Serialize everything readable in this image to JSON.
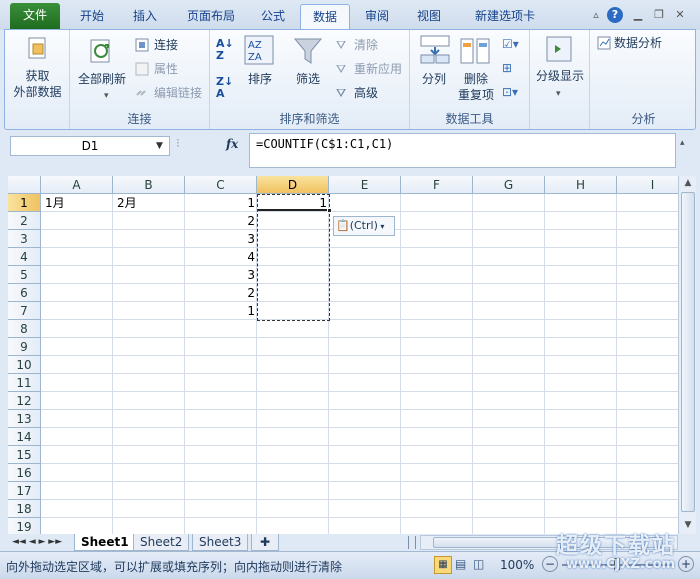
{
  "tabs": {
    "file": "文件",
    "items": [
      "开始",
      "插入",
      "页面布局",
      "公式",
      "数据",
      "审阅",
      "视图",
      "新建选项卡"
    ],
    "active": "数据"
  },
  "ribbon": {
    "get_external": {
      "label": "获取\n外部数据"
    },
    "connections_group": {
      "refresh_all": "全部刷新",
      "connections": "连接",
      "properties": "属性",
      "edit_links": "编辑链接",
      "group_label": "连接"
    },
    "sort_group": {
      "sort": "排序",
      "filter": "筛选",
      "clear": "清除",
      "reapply": "重新应用",
      "advanced": "高级",
      "group_label": "排序和筛选"
    },
    "tools_group": {
      "text_to_columns": "分列",
      "remove_duplicates": "删除\n重复项",
      "group_label": "数据工具"
    },
    "outline_group": {
      "outline": "分级显示",
      "group_label": "分析"
    },
    "analysis": {
      "data_analysis": "数据分析"
    }
  },
  "formula_bar": {
    "name_box": "D1",
    "fx": "fx",
    "formula": "=COUNTIF(C$1:C1,C1)"
  },
  "grid": {
    "columns": [
      "A",
      "B",
      "C",
      "D",
      "E",
      "F",
      "G",
      "H",
      "I"
    ],
    "rows": [
      "1",
      "2",
      "3",
      "4",
      "5",
      "6",
      "7",
      "8",
      "9",
      "10",
      "11",
      "12",
      "13",
      "14",
      "15",
      "16",
      "17",
      "18",
      "19"
    ],
    "cells": {
      "A1": "1月",
      "B1": "2月",
      "C1": "1",
      "C2": "2",
      "C3": "3",
      "C4": "4",
      "C5": "3",
      "C6": "2",
      "C7": "1",
      "D1": "1"
    },
    "paste_options": "(Ctrl)"
  },
  "sheets": [
    "Sheet1",
    "Sheet2",
    "Sheet3"
  ],
  "status": {
    "message": "向外拖动选定区域，可以扩展或填充序列；向内拖动则进行清除",
    "zoom": "100%"
  },
  "watermark": {
    "text": "超级下载站",
    "url": "www.CJXZ.com"
  }
}
